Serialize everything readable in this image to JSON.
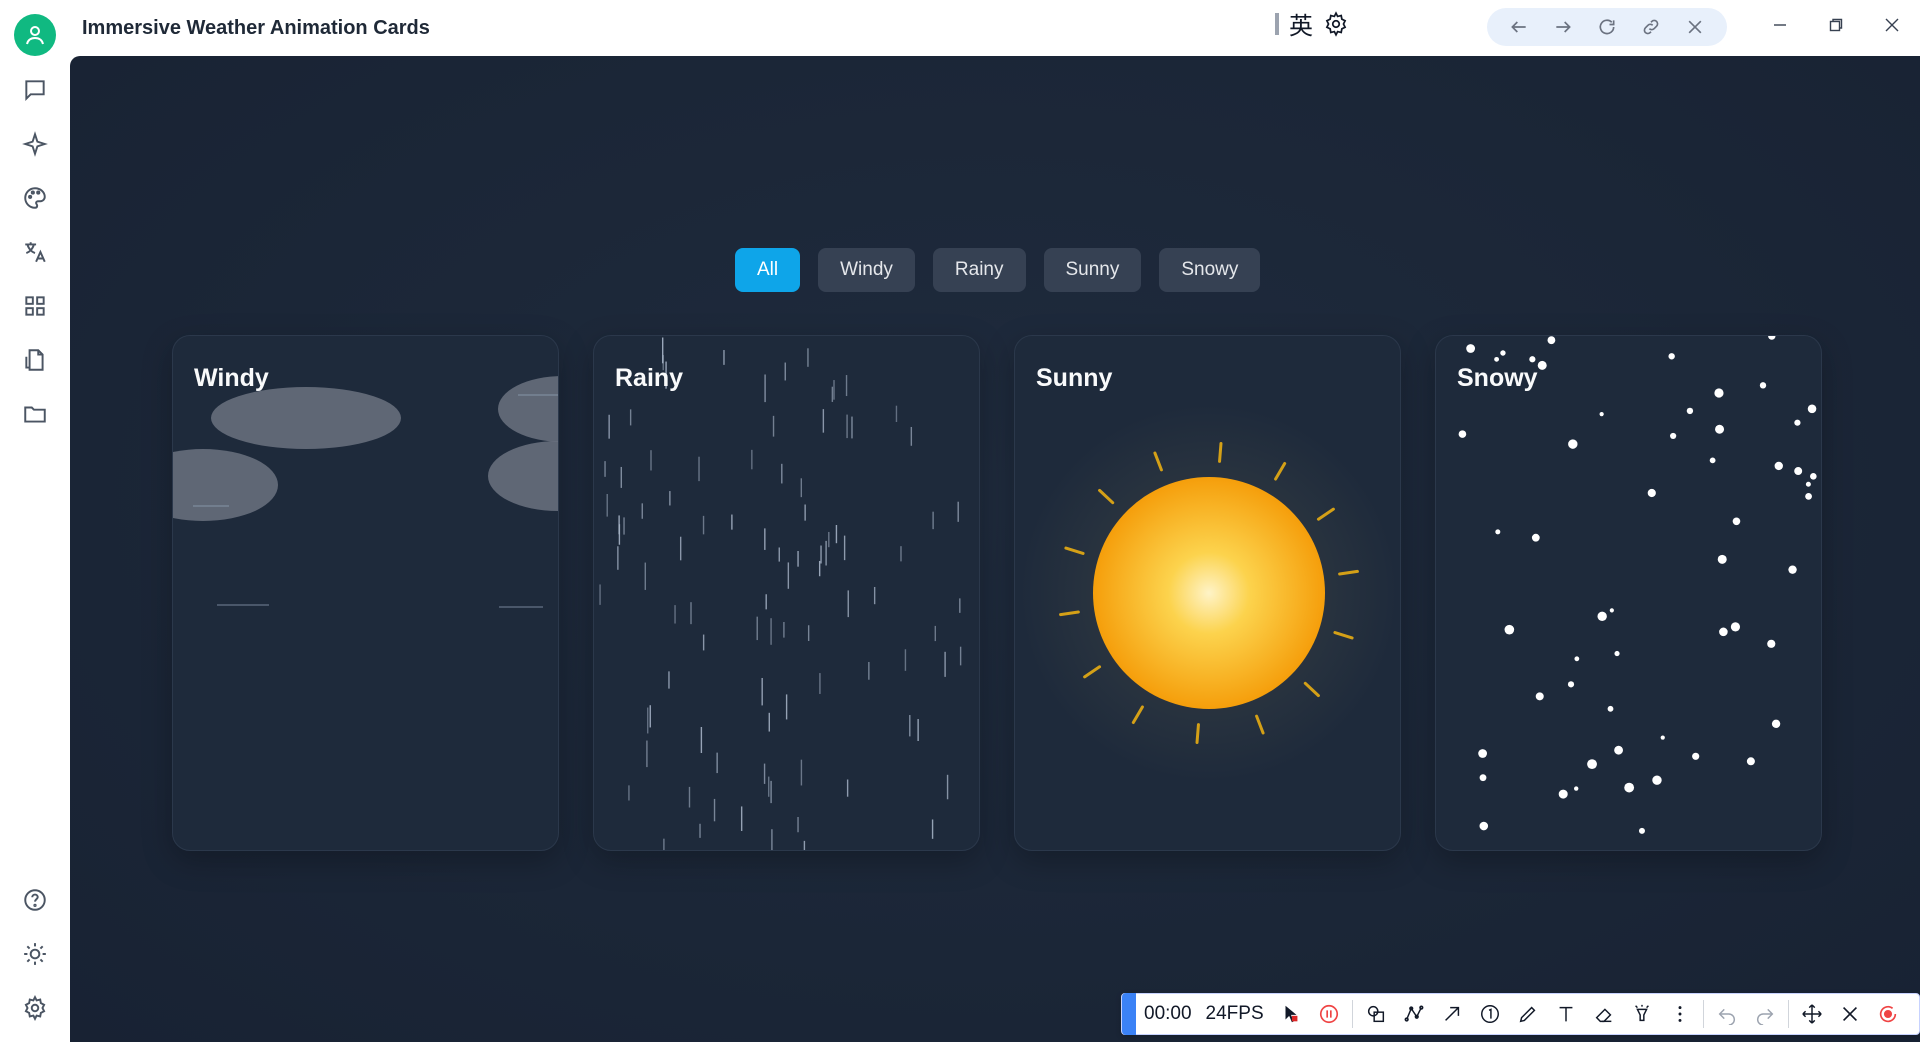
{
  "window": {
    "title": "Immersive Weather Animation Cards",
    "ime_char": "英"
  },
  "colors": {
    "accent": "#0ea5e9",
    "avatar": "#10b981",
    "sun_core": "#fde68a",
    "sun_edge": "#f59e0b",
    "record_red": "#ef4444"
  },
  "sidebar": {
    "items": [
      {
        "icon": "chat-icon"
      },
      {
        "icon": "sparkle-icon"
      },
      {
        "icon": "palette-icon"
      },
      {
        "icon": "translate-icon"
      },
      {
        "icon": "apps-grid-icon"
      },
      {
        "icon": "document-swap-icon"
      },
      {
        "icon": "folder-icon"
      }
    ],
    "bottom": [
      {
        "icon": "help-icon"
      },
      {
        "icon": "theme-sun-icon"
      },
      {
        "icon": "settings-gear-icon"
      }
    ]
  },
  "filters": {
    "items": [
      "All",
      "Windy",
      "Rainy",
      "Sunny",
      "Snowy"
    ],
    "active": "All"
  },
  "cards": [
    {
      "id": "windy",
      "title": "Windy"
    },
    {
      "id": "rainy",
      "title": "Rainy"
    },
    {
      "id": "sunny",
      "title": "Sunny"
    },
    {
      "id": "snowy",
      "title": "Snowy"
    }
  ],
  "recorder": {
    "time": "00:00",
    "fps": "24FPS"
  }
}
